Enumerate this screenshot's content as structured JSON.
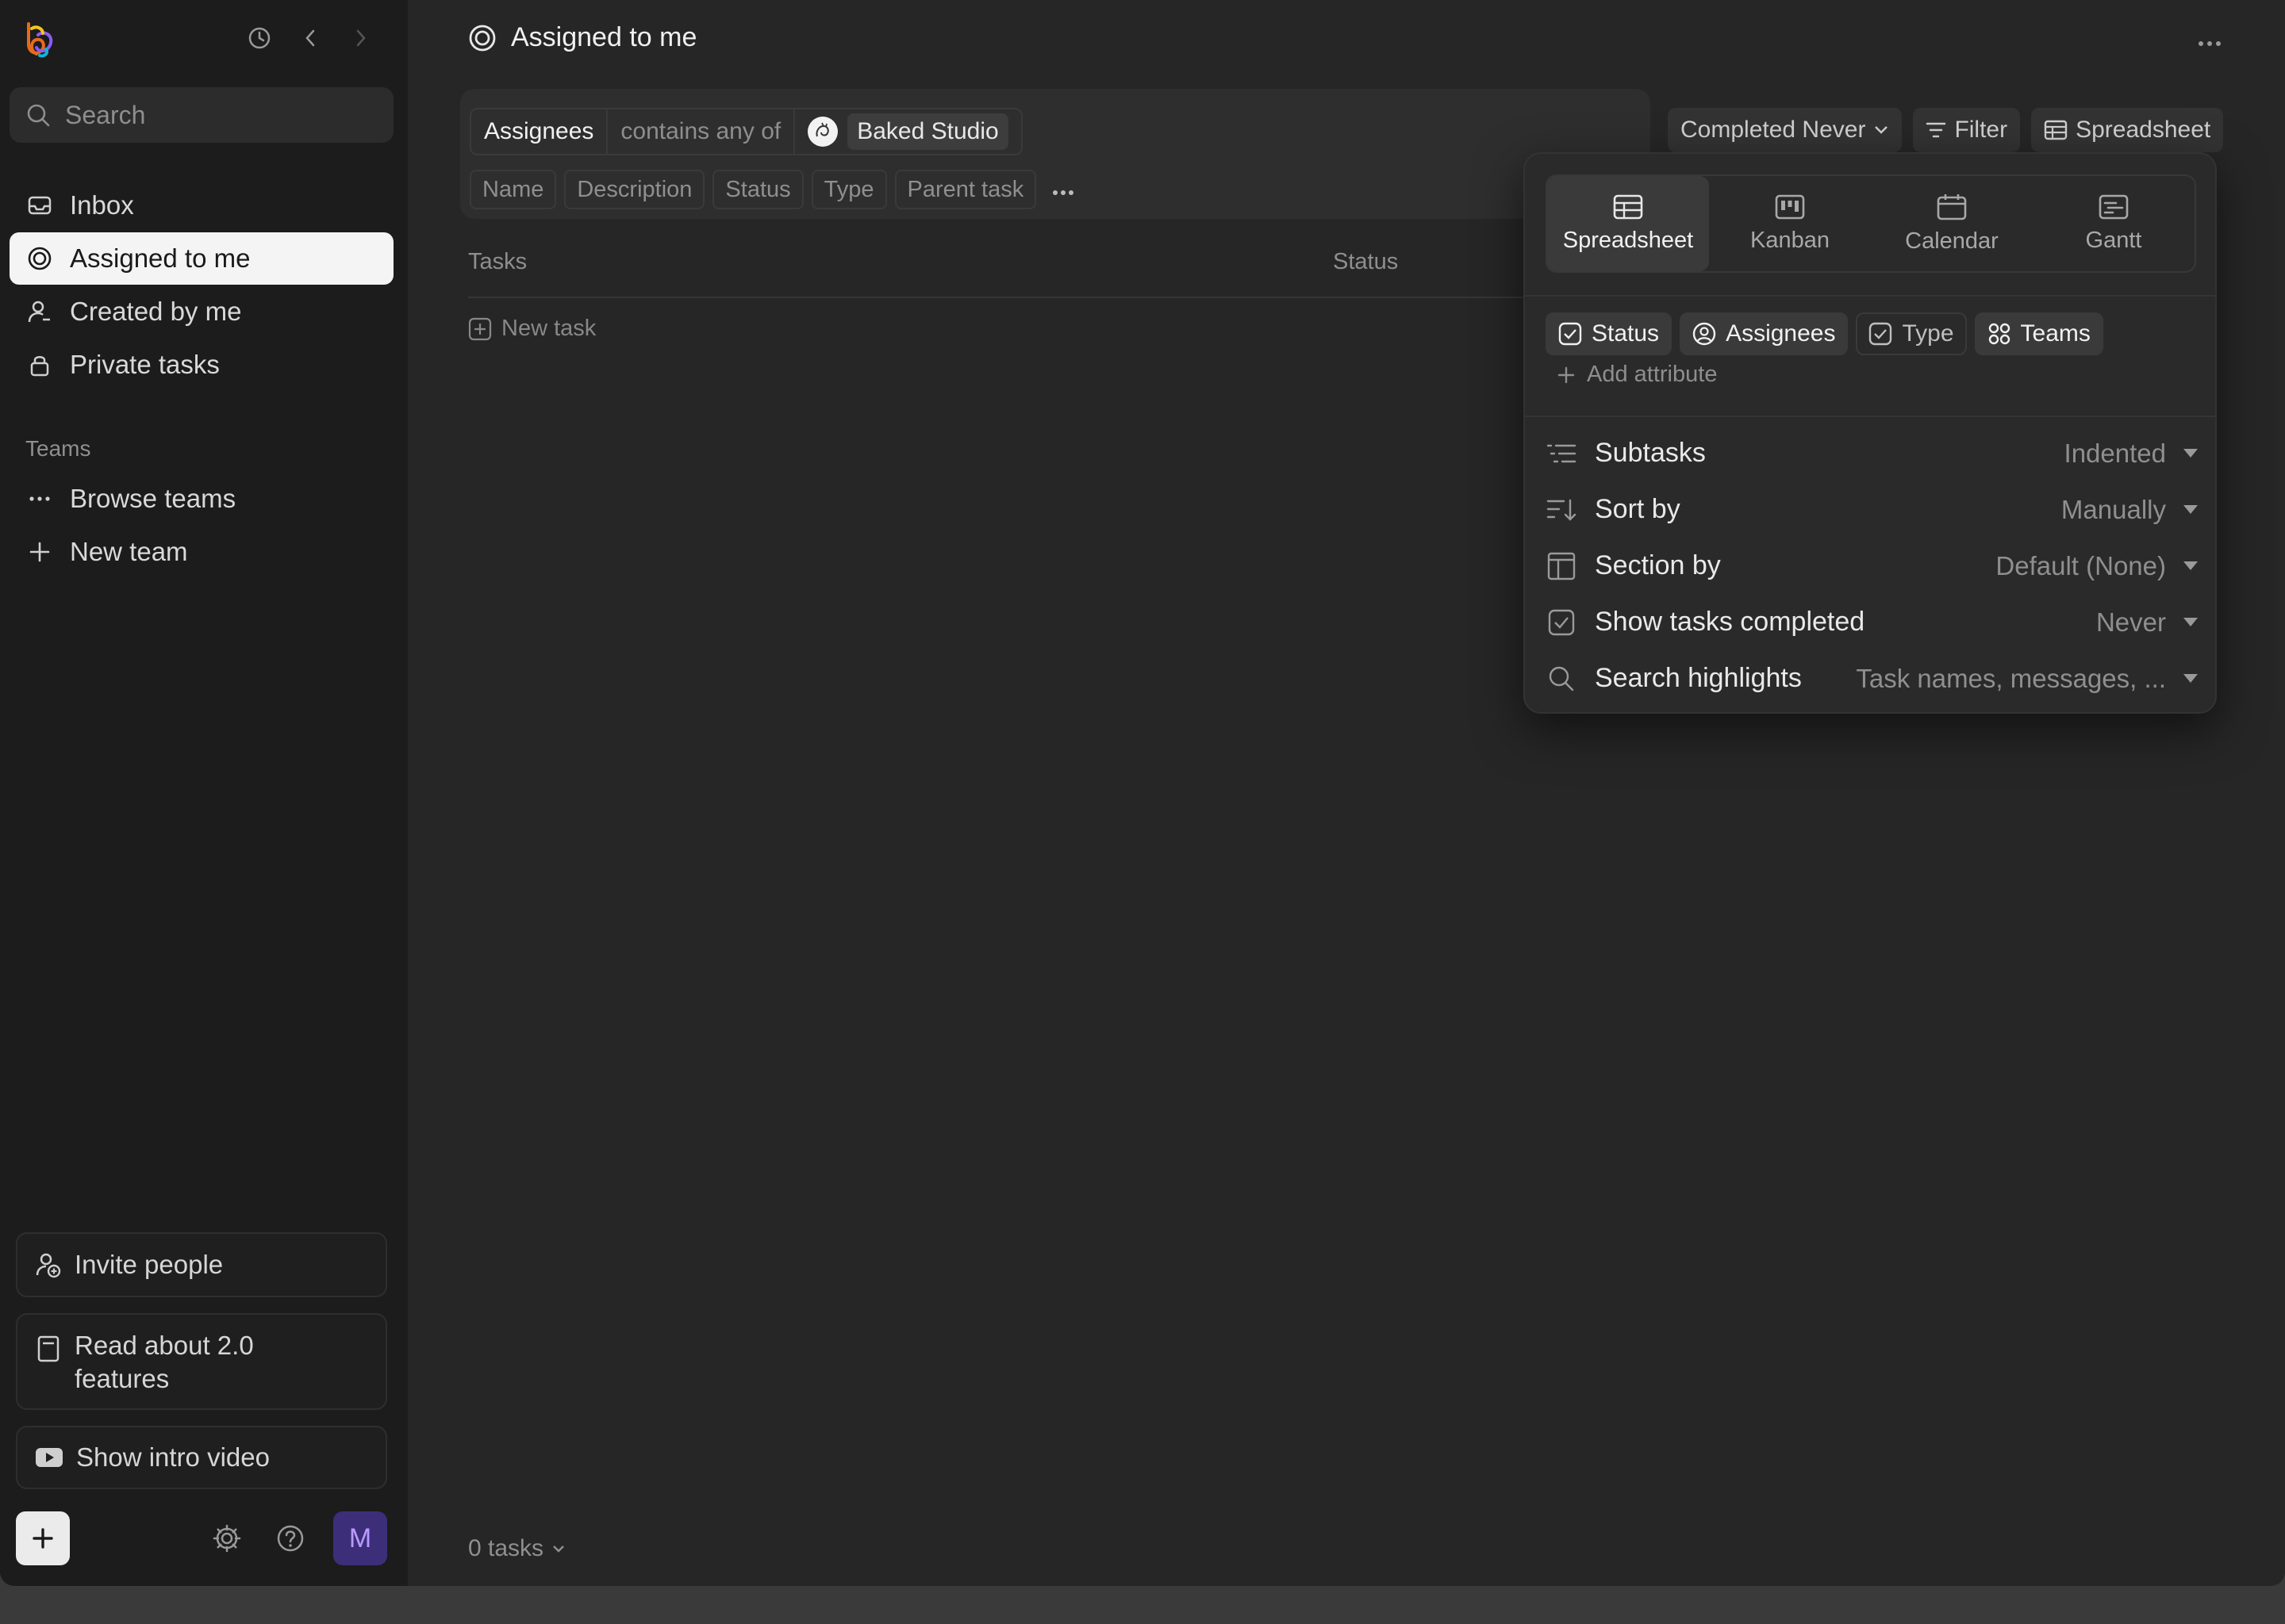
{
  "sidebar": {
    "search_placeholder": "Search",
    "nav": [
      {
        "label": "Inbox",
        "icon": "inbox-icon"
      },
      {
        "label": "Assigned to me",
        "icon": "target-icon",
        "active": true
      },
      {
        "label": "Created by me",
        "icon": "user-icon"
      },
      {
        "label": "Private tasks",
        "icon": "lock-icon"
      }
    ],
    "teams_label": "Teams",
    "teams_nav": [
      {
        "label": "Browse teams",
        "icon": "ellipsis-icon"
      },
      {
        "label": "New team",
        "icon": "plus-icon"
      }
    ],
    "invite_label": "Invite people",
    "read_label": "Read about 2.0 features",
    "video_label": "Show intro video",
    "avatar_initial": "M"
  },
  "main": {
    "title": "Assigned to me",
    "filter": {
      "field": "Assignees",
      "operator": "contains any of",
      "value": "Baked Studio"
    },
    "columns": [
      "Name",
      "Description",
      "Status",
      "Type",
      "Parent task"
    ],
    "completed_label": "Completed Never",
    "filter_label": "Filter",
    "view_label": "Spreadsheet",
    "table_headers": {
      "tasks": "Tasks",
      "status": "Status"
    },
    "new_task_label": "New task",
    "footer_count": "0 tasks"
  },
  "popover": {
    "views": [
      {
        "label": "Spreadsheet",
        "active": true
      },
      {
        "label": "Kanban"
      },
      {
        "label": "Calendar"
      },
      {
        "label": "Gantt"
      }
    ],
    "attributes": [
      {
        "label": "Status",
        "on": true
      },
      {
        "label": "Assignees",
        "on": true
      },
      {
        "label": "Type",
        "on": false
      },
      {
        "label": "Teams",
        "on": true
      }
    ],
    "add_attribute": "Add attribute",
    "settings": [
      {
        "label": "Subtasks",
        "value": "Indented"
      },
      {
        "label": "Sort by",
        "value": "Manually"
      },
      {
        "label": "Section by",
        "value": "Default (None)"
      },
      {
        "label": "Show tasks completed",
        "value": "Never"
      },
      {
        "label": "Search highlights",
        "value": "Task names, messages, ..."
      }
    ]
  }
}
